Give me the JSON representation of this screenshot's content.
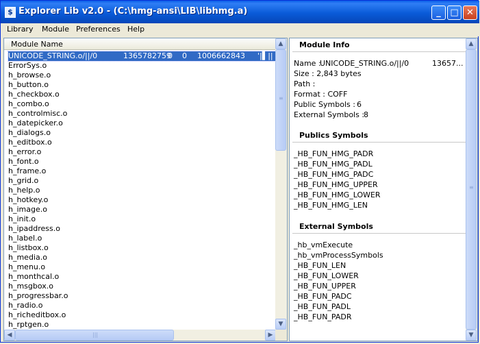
{
  "window": {
    "title": "Explorer Lib v2.0 - (C:\\hmg-ansi\\LIB\\libhmg.a)",
    "icon": "app-icon"
  },
  "menu": [
    "Library",
    "Module",
    "Preferences",
    "Help"
  ],
  "list": {
    "header": "Module Name",
    "selected": {
      "name": "UNICODE_STRING.o/||/0",
      "c1": "1365782759",
      "c2": "0",
      "c3": "0",
      "c4": "100666",
      "c5": "2843",
      "c6": "'|▌||"
    },
    "items": [
      "ErrorSys.o",
      "h_browse.o",
      "h_button.o",
      "h_checkbox.o",
      "h_combo.o",
      "h_controlmisc.o",
      "h_datepicker.o",
      "h_dialogs.o",
      "h_editbox.o",
      "h_error.o",
      "h_font.o",
      "h_frame.o",
      "h_grid.o",
      "h_help.o",
      "h_hotkey.o",
      "h_image.o",
      "h_init.o",
      "h_ipaddress.o",
      "h_label.o",
      "h_listbox.o",
      "h_media.o",
      "h_menu.o",
      "h_monthcal.o",
      "h_msgbox.o",
      "h_progressbar.o",
      "h_radio.o",
      "h_richeditbox.o",
      "h_rptgen.o"
    ]
  },
  "info": {
    "module_title": "Module Info",
    "name_label": "Name :",
    "name_value": "UNICODE_STRING.o/||/0",
    "name_extra": "13657...",
    "size_line": "Size : 2,843 bytes",
    "path_line": "Path :",
    "format_line": "Format : COFF",
    "public_label": "Public Symbols :",
    "public_value": "6",
    "external_label": "External Symbols :",
    "external_value": "8",
    "publics_title": "Publics Symbols",
    "publics": [
      "_HB_FUN_HMG_PADR",
      "_HB_FUN_HMG_PADL",
      "_HB_FUN_HMG_PADC",
      "_HB_FUN_HMG_UPPER",
      "_HB_FUN_HMG_LOWER",
      "_HB_FUN_HMG_LEN"
    ],
    "external_title": "External Symbols",
    "externals": [
      "_hb_vmExecute",
      "_hb_vmProcessSymbols",
      "_HB_FUN_LEN",
      "_HB_FUN_LOWER",
      "_HB_FUN_UPPER",
      "_HB_FUN_PADC",
      "_HB_FUN_PADL",
      "_HB_FUN_PADR"
    ]
  }
}
